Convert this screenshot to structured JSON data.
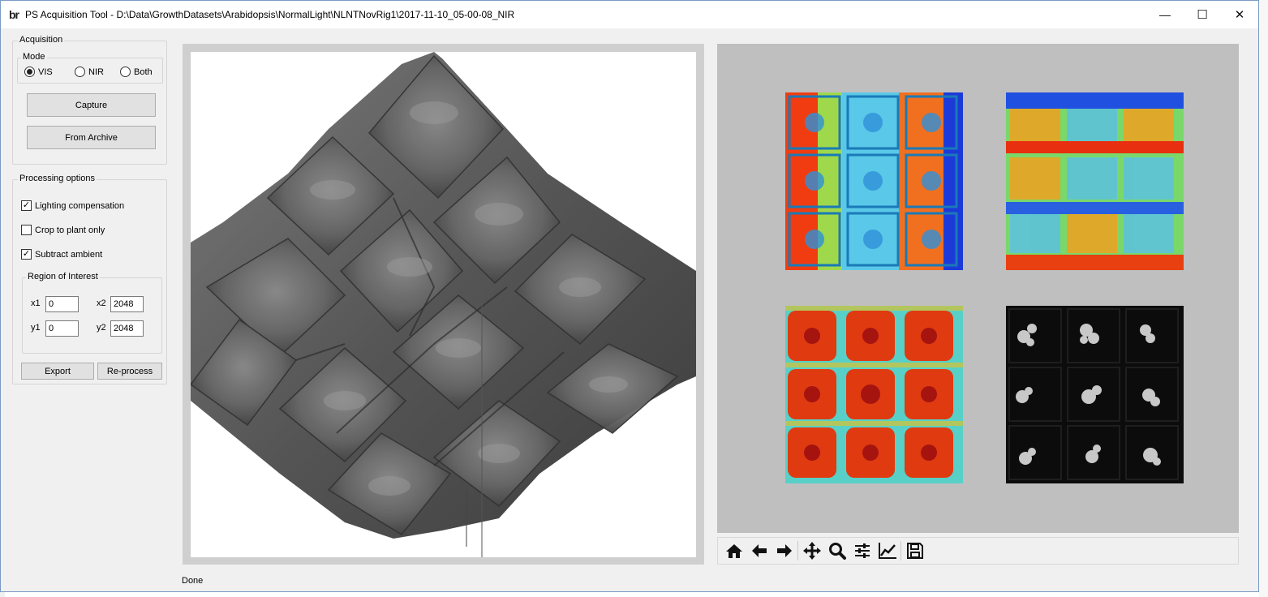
{
  "window": {
    "app_icon_text": "br",
    "title": "PS Acquisition Tool - D:\\Data\\GrowthDatasets\\Arabidopsis\\NormalLight\\NLNTNovRig1\\2017-11-10_05-00-08_NIR",
    "minimize_glyph": "—",
    "maximize_glyph": "☐",
    "close_glyph": "✕"
  },
  "acquisition": {
    "group_title": "Acquisition",
    "mode_title": "Mode",
    "modes": [
      {
        "label": "VIS",
        "selected": true
      },
      {
        "label": "NIR",
        "selected": false
      },
      {
        "label": "Both",
        "selected": false
      }
    ],
    "capture_label": "Capture",
    "archive_label": "From Archive"
  },
  "processing": {
    "group_title": "Processing options",
    "options": [
      {
        "label": "Lighting compensation",
        "checked": true
      },
      {
        "label": "Crop to plant only",
        "checked": false
      },
      {
        "label": "Subtract ambient",
        "checked": true
      }
    ],
    "check_glyph": "✓",
    "roi": {
      "title": "Region of Interest",
      "x1_label": "x1",
      "x1": "0",
      "x2_label": "x2",
      "x2": "2048",
      "y1_label": "y1",
      "y1": "0",
      "y2_label": "y2",
      "y2": "2048"
    },
    "export_label": "Export",
    "reprocess_label": "Re-process"
  },
  "toolbar": {
    "icons": [
      "home-icon",
      "back-arrow-icon",
      "forward-arrow-icon",
      "pan-icon",
      "zoom-icon",
      "configure-subplots-icon",
      "edit-axes-icon",
      "save-icon"
    ]
  },
  "status": {
    "text": "Done"
  },
  "colors": {
    "window_bg": "#f0f0f0",
    "surface_panel": "#cfcfcf",
    "image_panel": "#bfbfbf",
    "surface_gray": "#5a5a5a"
  }
}
